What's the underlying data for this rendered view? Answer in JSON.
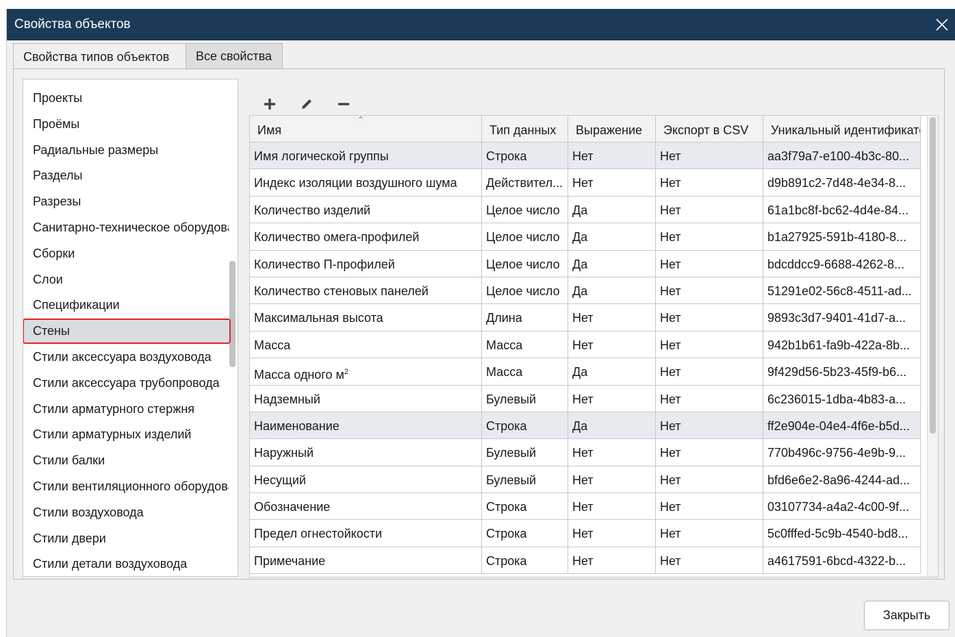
{
  "window": {
    "title": "Свойства объектов",
    "close_icon": "close-icon",
    "title_bar_color": "#1b3a57"
  },
  "tabs": [
    {
      "label": "Свойства типов объектов",
      "active": true
    },
    {
      "label": "Все свойства",
      "active": false
    }
  ],
  "object_types": {
    "items": [
      "Проекты",
      "Проёмы",
      "Радиальные размеры",
      "Разделы",
      "Разрезы",
      "Санитарно-техническое оборудование",
      "Сборки",
      "Слои",
      "Спецификации",
      "Стены",
      "Стили аксессуара воздуховода",
      "Стили аксессуара трубопровода",
      "Стили арматурного стержня",
      "Стили арматурных изделий",
      "Стили балки",
      "Стили вентиляционного оборудования",
      "Стили воздуховода",
      "Стили двери",
      "Стили детали воздуховода"
    ],
    "selected": "Стены",
    "selection_border_color": "#e0232b"
  },
  "toolbar": {
    "add_icon": "plus-icon",
    "edit_icon": "pencil-icon",
    "remove_icon": "minus-icon"
  },
  "table": {
    "columns": [
      "Имя",
      "Тип данных",
      "Выражение",
      "Экспорт в CSV",
      "Уникальный идентификатор"
    ],
    "sorted_column": "Имя",
    "rows": [
      {
        "name": "Имя логической группы",
        "type": "Строка",
        "expr": "Нет",
        "csv": "Нет",
        "guid": "aa3f79a7-e100-4b3c-80...",
        "highlight": true
      },
      {
        "name": "Индекс изоляции воздушного шума",
        "type": "Действител...",
        "expr": "Нет",
        "csv": "Нет",
        "guid": "d9b891c2-7d48-4e34-8..."
      },
      {
        "name": "Количество изделий",
        "type": "Целое число",
        "expr": "Да",
        "csv": "Нет",
        "guid": "61a1bc8f-bc62-4d4e-84..."
      },
      {
        "name": "Количество омега-профилей",
        "type": "Целое число",
        "expr": "Да",
        "csv": "Нет",
        "guid": "b1a27925-591b-4180-8..."
      },
      {
        "name": "Количество П-профилей",
        "type": "Целое число",
        "expr": "Да",
        "csv": "Нет",
        "guid": "bdcddcc9-6688-4262-8..."
      },
      {
        "name": "Количество стеновых панелей",
        "type": "Целое число",
        "expr": "Да",
        "csv": "Нет",
        "guid": "51291e02-56c8-4511-ad..."
      },
      {
        "name": "Максимальная высота",
        "type": "Длина",
        "expr": "Нет",
        "csv": "Нет",
        "guid": "9893c3d7-9401-41d7-a..."
      },
      {
        "name": "Масса",
        "type": "Масса",
        "expr": "Нет",
        "csv": "Нет",
        "guid": "942b1b61-fa9b-422a-8b..."
      },
      {
        "name": "Масса одного м",
        "name_sup": "2",
        "type": "Масса",
        "expr": "Да",
        "csv": "Нет",
        "guid": "9f429d56-5b23-45f9-b6..."
      },
      {
        "name": "Надземный",
        "type": "Булевый",
        "expr": "Нет",
        "csv": "Нет",
        "guid": "6c236015-1dba-4b83-a..."
      },
      {
        "name": "Наименование",
        "type": "Строка",
        "expr": "Да",
        "csv": "Нет",
        "guid": "ff2e904e-04e4-4f6e-b5d...",
        "highlight": true
      },
      {
        "name": "Наружный",
        "type": "Булевый",
        "expr": "Нет",
        "csv": "Нет",
        "guid": "770b496c-9756-4e9b-9..."
      },
      {
        "name": "Несущий",
        "type": "Булевый",
        "expr": "Нет",
        "csv": "Нет",
        "guid": "bfd6e6e2-8a96-4244-ad..."
      },
      {
        "name": "Обозначение",
        "type": "Строка",
        "expr": "Нет",
        "csv": "Нет",
        "guid": "03107734-a4a2-4c00-9f..."
      },
      {
        "name": "Предел огнестойкости",
        "type": "Строка",
        "expr": "Нет",
        "csv": "Нет",
        "guid": "5c0fffed-5c9b-4540-bd8..."
      },
      {
        "name": "Примечание",
        "type": "Строка",
        "expr": "Нет",
        "csv": "Нет",
        "guid": "a4617591-6bcd-4322-b..."
      }
    ]
  },
  "footer": {
    "close_label": "Закрыть"
  }
}
